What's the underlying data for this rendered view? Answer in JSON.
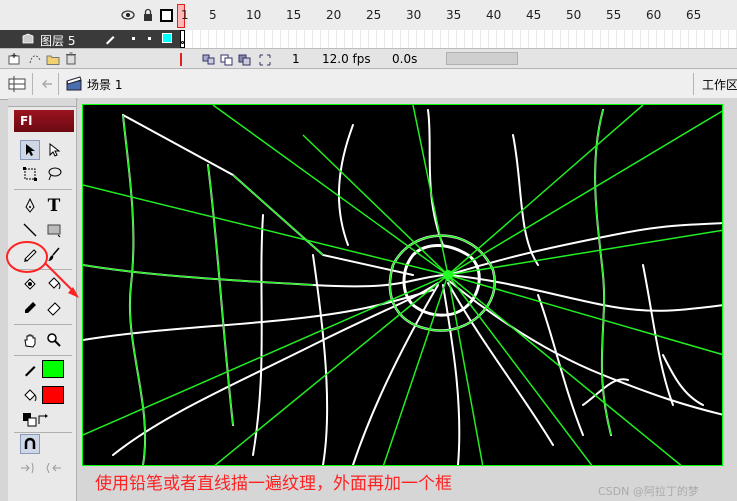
{
  "timeline": {
    "ruler": [
      "1",
      "5",
      "10",
      "15",
      "20",
      "25",
      "30",
      "35",
      "40",
      "45",
      "50",
      "55",
      "60",
      "65"
    ],
    "layer_name": "图层 5",
    "frame_number": "1",
    "fps": "12.0 fps",
    "time": "0.0s"
  },
  "editbar": {
    "scene": "场景 1",
    "workspace": "工作区"
  },
  "tools": {
    "logo": "Fl",
    "text_tool": "T"
  },
  "colors": {
    "stroke": "#00ff00",
    "fill": "#ff0000",
    "annotation": "#ff2222"
  },
  "annotation": {
    "caption": "使用铅笔或者直线描一遍纹理，外面再加一个框",
    "watermark": "CSDN @阿拉丁的梦"
  }
}
